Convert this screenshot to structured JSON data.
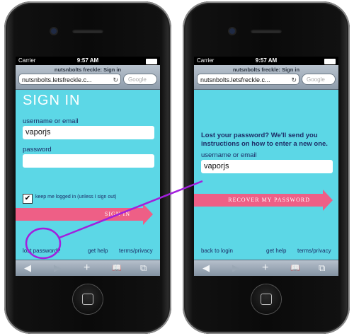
{
  "status": {
    "carrier": "Carrier",
    "time": "9:57 AM"
  },
  "browser": {
    "page_title": "nutsnbolts freckle: Sign in",
    "address": "nutsnbolts.letsfreckle.c...",
    "search_placeholder": "Google"
  },
  "signin": {
    "heading": "SIGN IN",
    "username_label": "username or email",
    "username_value": "vaporjs",
    "password_label": "password",
    "password_value": "",
    "remember_label": "keep me logged in (unless I sign out)",
    "remember_checked": "✔",
    "submit_label": "SIGN IN",
    "lost_password_link": "lost password?",
    "get_help_link": "get help",
    "terms_link": "terms/privacy"
  },
  "recover": {
    "instructions": "Lost your password? We'll send you instructions on how to enter a new one.",
    "username_label": "username or email",
    "username_value": "vaporjs",
    "submit_label": "RECOVER MY PASSWORD",
    "back_link": "back to login",
    "get_help_link": "get help",
    "terms_link": "terms/privacy"
  },
  "toolbar": {
    "back": "◀",
    "forward": "▶",
    "add": "+",
    "bookmarks": "📖",
    "pages": "⧉"
  },
  "colors": {
    "page_bg": "#5cd7e6",
    "arrow": "#ee5f86",
    "annotation": "#a21fdd",
    "label": "#1c2c66"
  }
}
